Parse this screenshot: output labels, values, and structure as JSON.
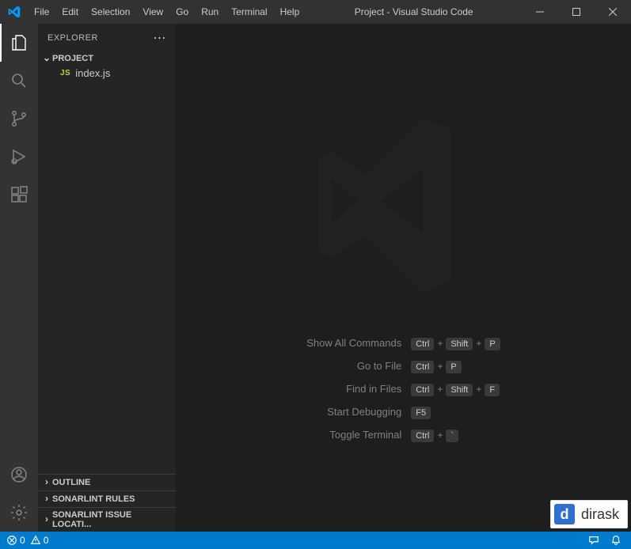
{
  "titlebar": {
    "menu": [
      "File",
      "Edit",
      "Selection",
      "View",
      "Go",
      "Run",
      "Terminal",
      "Help"
    ],
    "title": "Project - Visual Studio Code"
  },
  "sidebar": {
    "header": "EXPLORER",
    "project": "PROJECT",
    "files": [
      {
        "icon": "JS",
        "name": "index.js"
      }
    ],
    "collapsed": [
      "OUTLINE",
      "SONARLINT RULES",
      "SONARLINT ISSUE LOCATI..."
    ]
  },
  "welcome": {
    "shortcuts": [
      {
        "label": "Show All Commands",
        "keys": [
          "Ctrl",
          "Shift",
          "P"
        ]
      },
      {
        "label": "Go to File",
        "keys": [
          "Ctrl",
          "P"
        ]
      },
      {
        "label": "Find in Files",
        "keys": [
          "Ctrl",
          "Shift",
          "F"
        ]
      },
      {
        "label": "Start Debugging",
        "keys": [
          "F5"
        ]
      },
      {
        "label": "Toggle Terminal",
        "keys": [
          "Ctrl",
          "`"
        ]
      }
    ]
  },
  "statusbar": {
    "errors": "0",
    "warnings": "0"
  },
  "watermark": {
    "brand": "dirask",
    "letter": "d"
  }
}
